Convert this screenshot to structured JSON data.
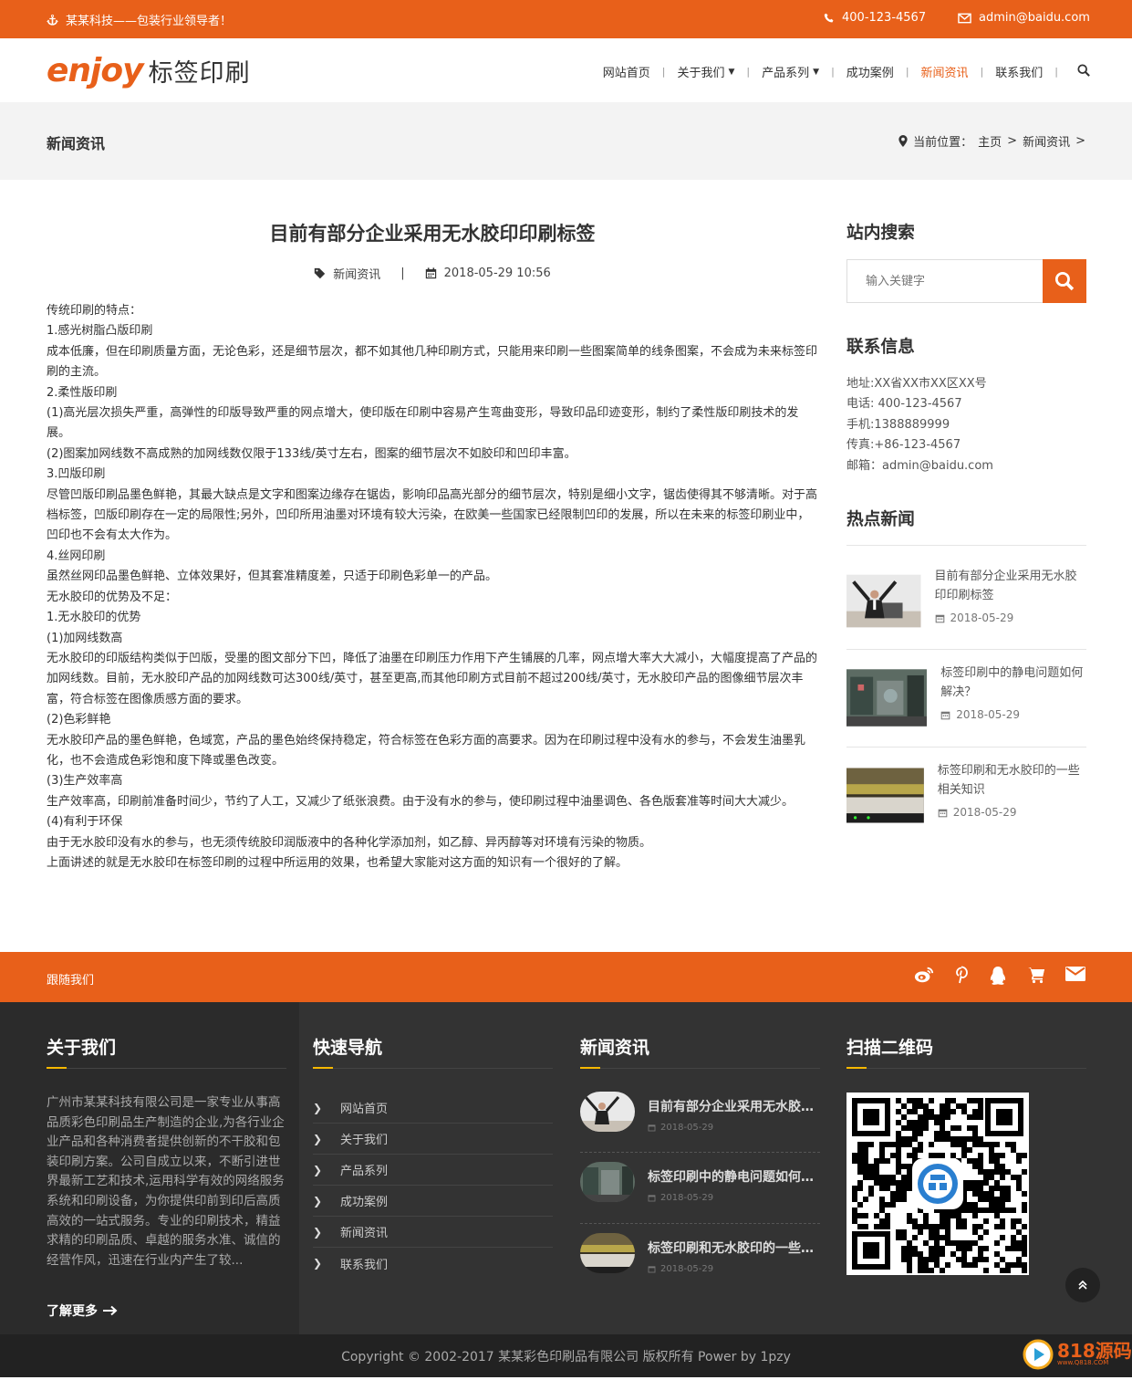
{
  "topbar": {
    "slogan": "某某科技——包装行业领导者！",
    "phone": "400-123-4567",
    "email": "admin@baidu.com"
  },
  "logo": {
    "en": "enjoy",
    "cn": "标签印刷"
  },
  "nav": [
    {
      "label": "网站首页",
      "dropdown": false,
      "active": false
    },
    {
      "label": "关于我们",
      "dropdown": true,
      "active": false
    },
    {
      "label": "产品系列",
      "dropdown": true,
      "active": false
    },
    {
      "label": "成功案例",
      "dropdown": false,
      "active": false
    },
    {
      "label": "新闻资讯",
      "dropdown": false,
      "active": true
    },
    {
      "label": "联系我们",
      "dropdown": false,
      "active": false
    }
  ],
  "banner": {
    "title": "新闻资讯",
    "crumb_label": "当前位置：",
    "crumb_home": "主页",
    "crumb_current": "新闻资讯",
    "crumb_sep": ">"
  },
  "article": {
    "title": "目前有部分企业采用无水胶印印刷标签",
    "category": "新闻资讯",
    "datetime": "2018-05-29 10:56",
    "paragraphs": [
      "传统印刷的特点：",
      "1.感光树脂凸版印刷",
      "成本低廉，但在印刷质量方面，无论色彩，还是细节层次，都不如其他几种印刷方式，只能用来印刷一些图案简单的线条图案，不会成为未来标签印刷的主流。",
      "2.柔性版印刷",
      "(1)高光层次损失严重，高弹性的印版导致严重的网点增大，使印版在印刷中容易产生弯曲变形，导致印品印迹变形，制约了柔性版印刷技术的发展。",
      "(2)图案加网线数不高成熟的加网线数仅限于133线/英寸左右，图案的细节层次不如胶印和凹印丰富。",
      "3.凹版印刷",
      "尽管凹版印刷品墨色鲜艳，其最大缺点是文字和图案边缘存在锯齿，影响印品高光部分的细节层次，特别是细小文字，锯齿使得其不够清晰。对于高档标签，凹版印刷存在一定的局限性;另外，凹印所用油墨对环境有较大污染，在欧美一些国家已经限制凹印的发展，所以在未来的标签印刷业中，凹印也不会有太大作为。",
      "4.丝网印刷",
      "虽然丝网印品墨色鲜艳、立体效果好，但其套准精度差，只适于印刷色彩单一的产品。",
      "无水胶印的优势及不足：",
      "1.无水胶印的优势",
      "(1)加网线数高",
      " 无水胶印的印版结构类似于凹版，受墨的图文部分下凹，降低了油墨在印刷压力作用下产生铺展的几率，网点增大率大大减小，大幅度提高了产品的加网线数。目前，无水胶印产品的加网线数可达300线/英寸，甚至更高,而其他印刷方式目前不超过200线/英寸，无水胶印产品的图像细节层次丰富，符合标签在图像质感方面的要求。",
      "(2)色彩鲜艳",
      "无水胶印产品的墨色鲜艳，色域宽，产品的墨色始终保持稳定，符合标签在色彩方面的高要求。因为在印刷过程中没有水的参与，不会发生油墨乳化，也不会造成色彩饱和度下降或墨色改变。",
      "(3)生产效率高",
      "生产效率高，印刷前准备时间少，节约了人工，又减少了纸张浪费。由于没有水的参与，使印刷过程中油墨调色、各色版套准等时间大大减少。",
      "(4)有利于环保",
      "由于无水胶印没有水的参与，也无须传统胶印润版液中的各种化学添加剂，如乙醇、异丙醇等对环境有污染的物质。",
      "上面讲述的就是无水胶印在标签印刷的过程中所运用的效果，也希望大家能对这方面的知识有一个很好的了解。"
    ]
  },
  "sidebar": {
    "search_title": "站内搜索",
    "search_placeholder": "输入关键字",
    "contact_title": "联系信息",
    "contact": [
      "地址:XX省XX市XX区XX号",
      "电话: 400-123-4567",
      "手机:1388889999",
      "传真:+86-123-4567",
      "邮箱：admin@baidu.com"
    ],
    "hot_title": "热点新闻",
    "hot": [
      {
        "title": "目前有部分企业采用无水胶印印刷标签",
        "date": "2018-05-29"
      },
      {
        "title": "标签印刷中的静电问题如何解决？",
        "date": "2018-05-29"
      },
      {
        "title": "标签印刷和无水胶印的一些相关知识",
        "date": "2018-05-29"
      }
    ]
  },
  "follow": {
    "label": "跟随我们",
    "icons": [
      "weibo-icon",
      "pinterest-icon",
      "qq-icon",
      "cart-icon",
      "envelope-icon"
    ]
  },
  "footer": {
    "about_title": "关于我们",
    "about_text": "广州市某某科技有限公司是一家专业从事高品质彩色印刷品生产制造的企业,为各行业企业产品和各种消费者提供创新的不干胶和包装印刷方案。公司自成立以来，不断引进世界最新工艺和技术,运用科学有效的网络服务系统和印刷设备，为你提供印前到印后高质高效的一站式服务。专业的印刷技术，精益求精的印刷品质、卓越的服务水准、诚信的经营作风，迅速在行业内产生了较...",
    "more": "了解更多",
    "nav_title": "快速导航",
    "nav_items": [
      "网站首页",
      "关于我们",
      "产品系列",
      "成功案例",
      "新闻资讯",
      "联系我们"
    ],
    "news_title": "新闻资讯",
    "news": [
      {
        "title": "目前有部分企业采用无水胶印印刷标签",
        "date": "2018-05-29"
      },
      {
        "title": "标签印刷中的静电问题如何解决？",
        "date": "2018-05-29"
      },
      {
        "title": "标签印刷和无水胶印的一些相关知识",
        "date": "2018-05-29"
      }
    ],
    "qr_title": "扫描二维码"
  },
  "copyright": "Copyright © 2002-2017 某某彩色印刷品有限公司 版权所有 Power by 1pzy",
  "watermark": {
    "cn": "818源码",
    "sub": "www.Q818.COM"
  },
  "colors": {
    "accent": "#e8601a",
    "footer_bg": "#333333",
    "underline": "#f6b800"
  }
}
